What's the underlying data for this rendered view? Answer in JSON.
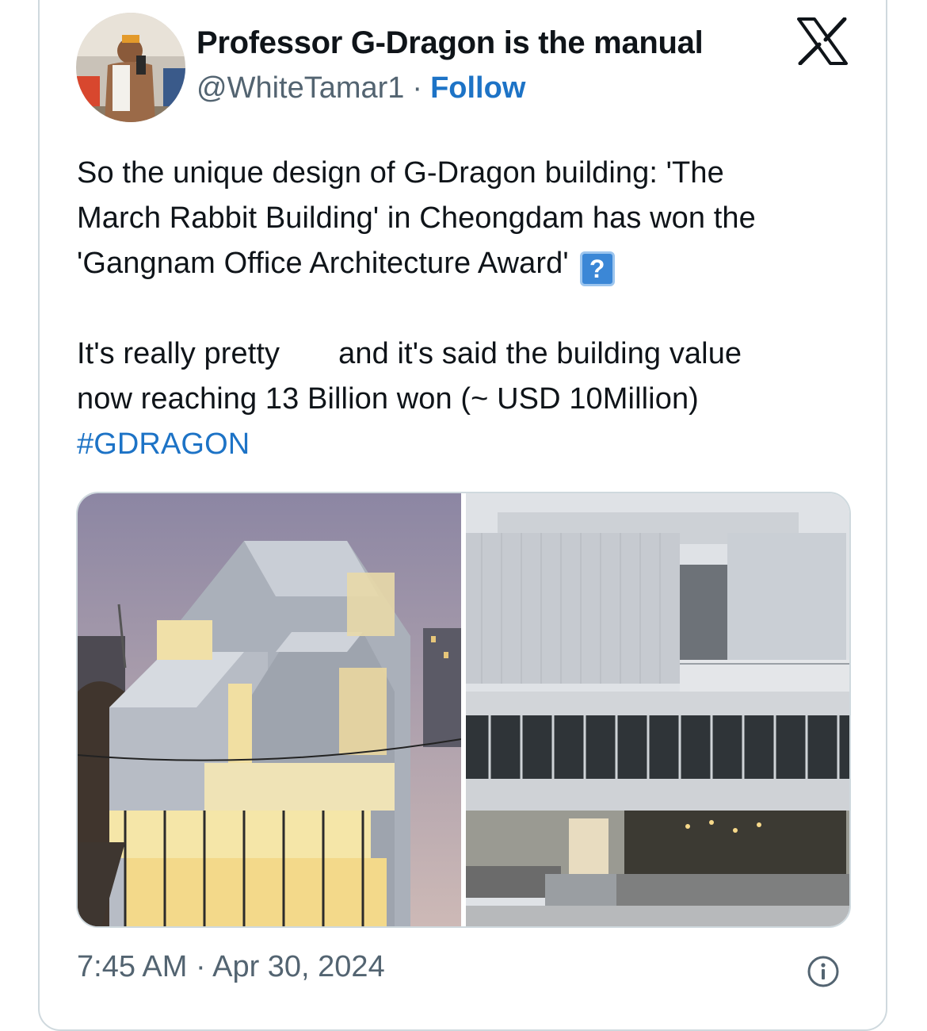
{
  "tweet": {
    "author_name": "Professor G-Dragon is the manual",
    "handle": "@WhiteTamar1",
    "separator": "·",
    "follow_label": "Follow",
    "text_lines": [
      "So the unique design of G-Dragon building: 'The",
      "March Rabbit Building' in Cheongdam has won the",
      "'Gangnam Office Architecture Award'"
    ],
    "emoji_glyph": "?",
    "text_line_4a": "It's really pretty",
    "text_line_4b": "and it's said the building value",
    "text_line_5": "now reaching 13 Billion won (~ USD 10Million)",
    "hashtag": "#GDRAGON",
    "timestamp": "7:45 AM · Apr 30, 2024"
  },
  "icons": {
    "platform_logo": "x-logo-icon",
    "info": "info-icon",
    "question_emoji": "question-emoji-icon"
  },
  "colors": {
    "link": "#1d73c6",
    "secondary_text": "#536471",
    "border": "#cfd9de"
  }
}
